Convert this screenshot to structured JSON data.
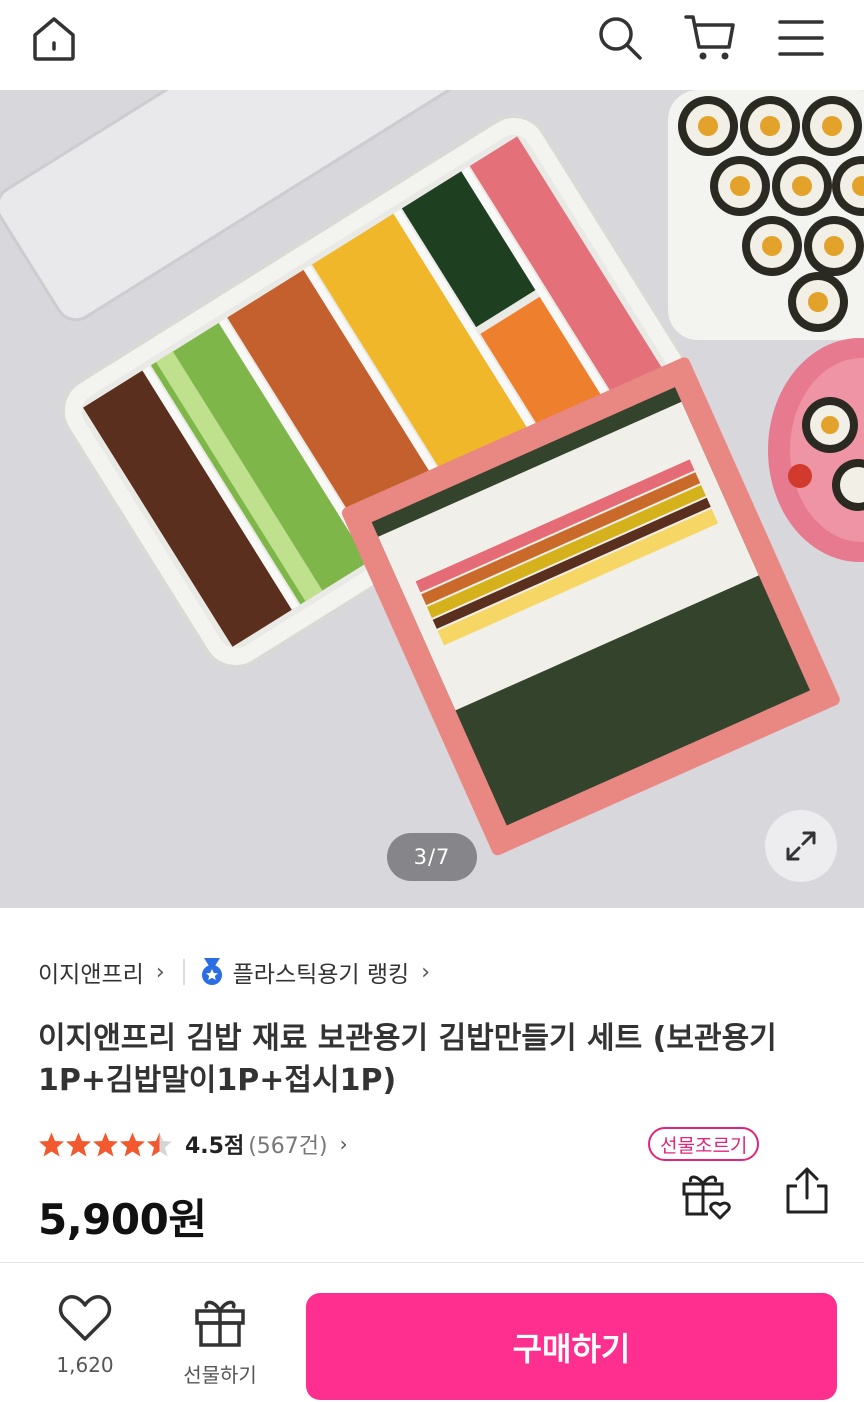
{
  "header": {
    "home_icon": "home-icon",
    "search_icon": "search-icon",
    "cart_icon": "cart-icon",
    "menu_icon": "menu-icon"
  },
  "gallery": {
    "counter": "3/7",
    "expand_icon": "expand-icon"
  },
  "breadcrumb": {
    "brand": "이지앤프리",
    "ranking": "플라스틱용기 랭킹"
  },
  "product": {
    "title": "이지앤프리 김밥 재료 보관용기 김밥만들기 세트 (보관용기 1P+김밥말이1P+접시1P)",
    "rating_value": 4.5,
    "rating_max": 5,
    "score_label": "4.5점",
    "review_count": "(567건)",
    "price": "5,900원",
    "gift_badge": "선물조르기"
  },
  "bottom_bar": {
    "like_count": "1,620",
    "gift_label": "선물하기",
    "buy_label": "구매하기"
  },
  "colors": {
    "accent": "#fe2f8e",
    "badge": "#e0267a",
    "star": "#f2592f"
  }
}
